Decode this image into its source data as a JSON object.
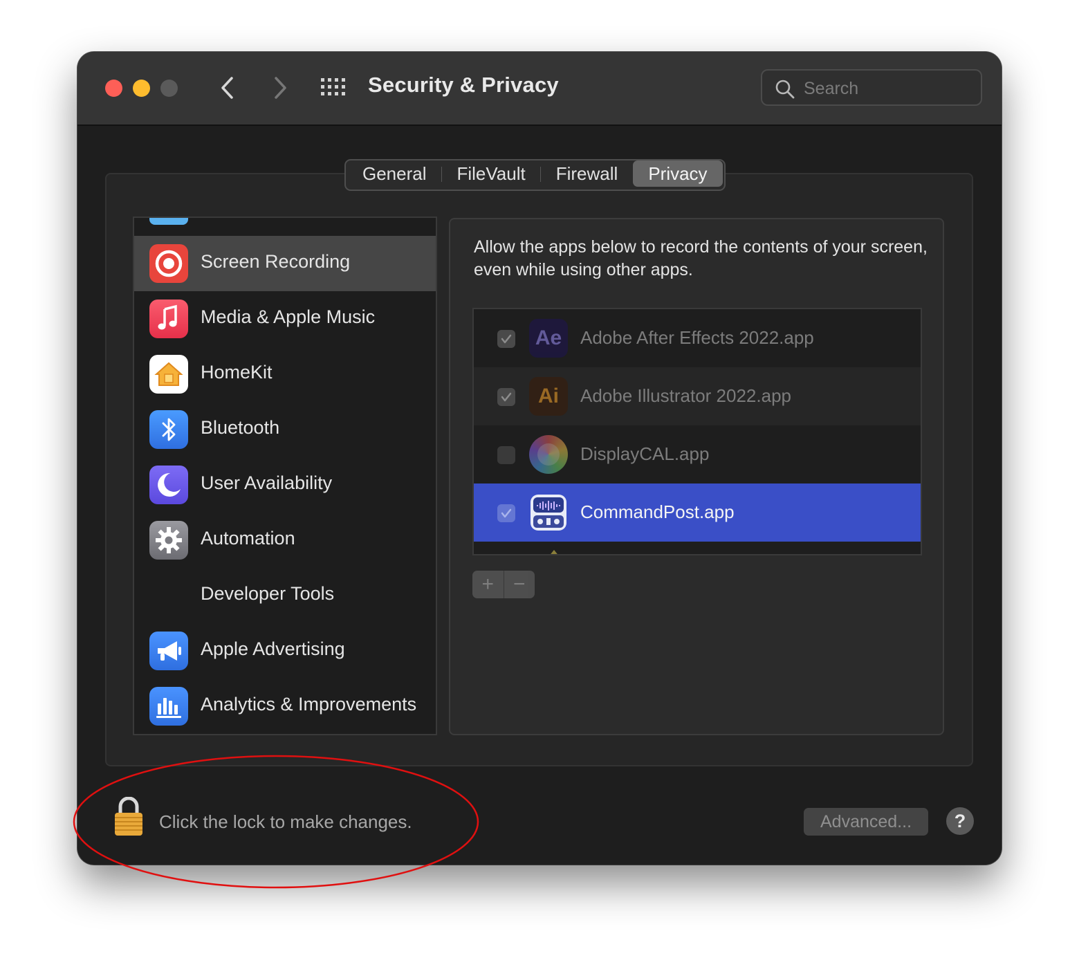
{
  "window": {
    "title": "Security & Privacy",
    "search_placeholder": "Search"
  },
  "tabs": [
    {
      "label": "General"
    },
    {
      "label": "FileVault"
    },
    {
      "label": "Firewall"
    },
    {
      "label": "Privacy"
    }
  ],
  "active_tab": "Privacy",
  "sidebar": {
    "items": [
      {
        "label": "Screen Recording",
        "icon": "screen-recording-icon",
        "color": "#e8453c",
        "selected": true
      },
      {
        "label": "Media & Apple Music",
        "icon": "music-note-icon",
        "color": "#f2485f"
      },
      {
        "label": "HomeKit",
        "icon": "home-icon",
        "color": "#ffffff"
      },
      {
        "label": "Bluetooth",
        "icon": "bluetooth-icon",
        "color": "#3b82f6"
      },
      {
        "label": "User Availability",
        "icon": "moon-icon",
        "color": "#6b5ef0"
      },
      {
        "label": "Automation",
        "icon": "gear-icon",
        "color": "#8e8e93"
      },
      {
        "label": "Developer Tools",
        "icon": "none"
      },
      {
        "label": "Apple Advertising",
        "icon": "megaphone-icon",
        "color": "#3a84f0"
      },
      {
        "label": "Analytics & Improvements",
        "icon": "bar-chart-icon",
        "color": "#3a84f0"
      }
    ]
  },
  "content": {
    "description": "Allow the apps below to record the contents of your screen, even while using other apps.",
    "apps": [
      {
        "name": "Adobe After Effects 2022.app",
        "icon_text": "Ae",
        "checked": true
      },
      {
        "name": "Adobe Illustrator 2022.app",
        "icon_text": "Ai",
        "checked": true
      },
      {
        "name": "DisplayCAL.app",
        "checked": false
      },
      {
        "name": "CommandPost.app",
        "checked": true,
        "selected": true
      }
    ],
    "add_label": "+",
    "remove_label": "−"
  },
  "footer": {
    "lock_text": "Click the lock to make changes.",
    "advanced_label": "Advanced...",
    "help_label": "?"
  },
  "colors": {
    "selection_blue": "#3a4fc7",
    "annotation_red": "#e01010",
    "window_bg": "#1e1e1e"
  }
}
